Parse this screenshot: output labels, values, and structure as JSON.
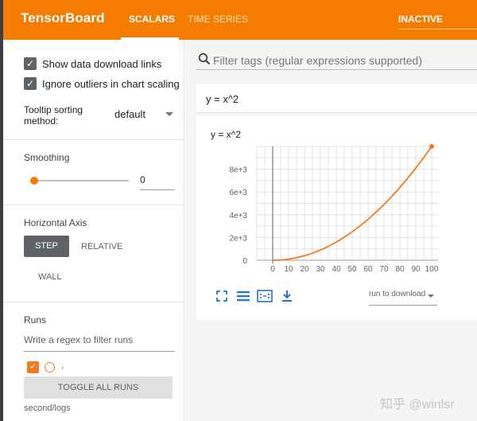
{
  "app": {
    "title": "TensorBoard"
  },
  "nav": {
    "tabs": [
      {
        "label": "SCALARS"
      },
      {
        "label": "TIME SERIES"
      }
    ],
    "status": "INACTIVE"
  },
  "sidebar": {
    "show_download_links": "Show data download links",
    "ignore_outliers": "Ignore outliers in chart scaling",
    "tooltip_label": "Tooltip sorting method:",
    "tooltip_value": "default",
    "smoothing_label": "Smoothing",
    "smoothing_value": "0",
    "horizontal_axis_label": "Horizontal Axis",
    "axis_options": [
      "STEP",
      "RELATIVE",
      "WALL"
    ],
    "runs_label": "Runs",
    "runs_placeholder": "Write a regex to filter runs",
    "run_name": ".",
    "toggle_all": "TOGGLE ALL RUNS",
    "logdir": "second/logs"
  },
  "main": {
    "filter_placeholder": "Filter tags (regular expressions supported)",
    "card_header": "y = x^2",
    "chart_title": "y = x^2",
    "run_select": "run to download"
  },
  "watermark": "知乎 @winlsr",
  "colors": {
    "accent": "#f57c00",
    "series": "#f4791f"
  },
  "chart_data": {
    "type": "line",
    "title": "y = x^2",
    "xlabel": "",
    "ylabel": "",
    "x": [
      0,
      10,
      20,
      30,
      40,
      50,
      60,
      70,
      80,
      90,
      100
    ],
    "series": [
      {
        "values": [
          0,
          100,
          400,
          900,
          1600,
          2500,
          3600,
          4900,
          6400,
          8100,
          10000
        ]
      }
    ],
    "x_ticks": [
      "0",
      "10",
      "20",
      "30",
      "40",
      "50",
      "60",
      "70",
      "80",
      "90",
      "100"
    ],
    "y_ticks": [
      "0",
      "2e+3",
      "4e+3",
      "6e+3",
      "8e+3"
    ],
    "xlim": [
      -10,
      104
    ],
    "ylim": [
      0,
      10000
    ],
    "grid": true
  }
}
